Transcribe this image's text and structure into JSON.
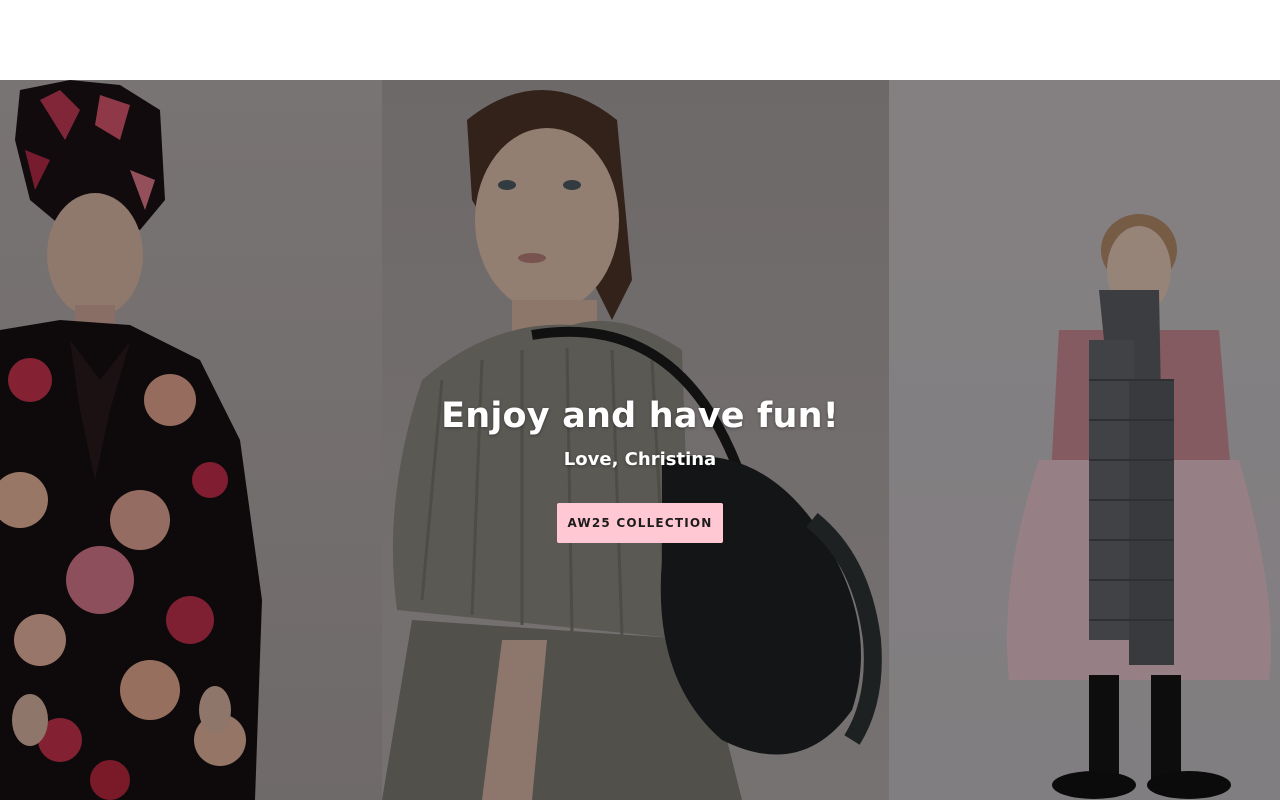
{
  "hero": {
    "title": "Enjoy and have fun!",
    "subtitle": "Love, Christina",
    "cta_label": "AW25 COLLECTION"
  },
  "colors": {
    "header_background": "#ffffff",
    "cta_background": "#ffc8d3",
    "cta_text": "#1c1c1c",
    "hero_text": "#ffffff"
  }
}
